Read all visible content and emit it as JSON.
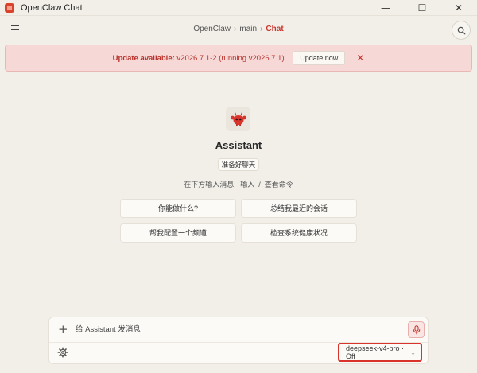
{
  "window": {
    "title": "OpenClaw Chat",
    "minimize_glyph": "—",
    "maximize_glyph": "☐",
    "close_glyph": "✕"
  },
  "header": {
    "breadcrumb": [
      "OpenClaw",
      "main",
      "Chat"
    ],
    "separator": "›"
  },
  "banner": {
    "title": "Update available:",
    "details": " v2026.7.1-2 (running v2026.7.1).",
    "button_label": "Update now",
    "close_glyph": "✕"
  },
  "assistant": {
    "name": "Assistant",
    "status_badge": "准备好聊天",
    "hint_left": "在下方输入消息 · 输入",
    "hint_slash": "/",
    "hint_right": "查看命令"
  },
  "suggestions": [
    "你能做什么?",
    "总结我最近的会话",
    "帮我配置一个频道",
    "检查系统健康状况"
  ],
  "composer": {
    "plus_glyph": "+",
    "placeholder": "给 Assistant 发消息",
    "value": "",
    "model_label": "deepseek-v4-pro · Off",
    "chevron_glyph": "⌄"
  },
  "colors": {
    "accent": "#c8362e",
    "banner_bg": "#f6d9d7",
    "page_bg": "#f2efe8"
  }
}
